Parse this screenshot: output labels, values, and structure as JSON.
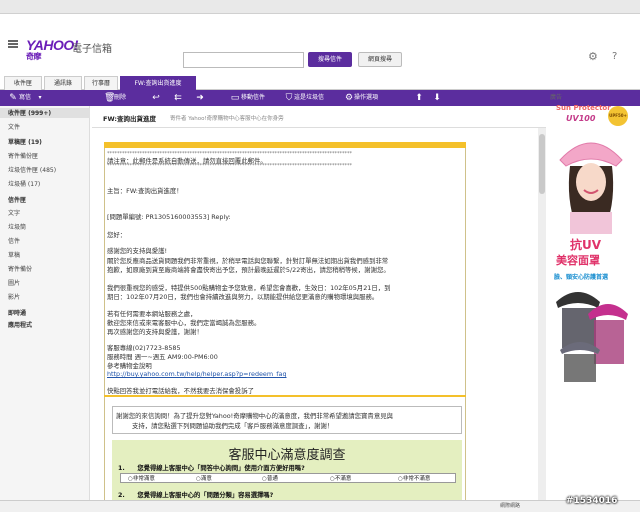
{
  "browser": {
    "bar": ""
  },
  "header": {
    "logo": "YAHOO!",
    "logo_sub": "奇摩",
    "mail_title": "電子信箱",
    "search_placeholder": "",
    "search_mail_label": "搜尋信件",
    "search_web_label": "網頁搜尋"
  },
  "tabs": [
    {
      "label": "收件匣"
    },
    {
      "label": "通訊錄"
    },
    {
      "label": "行事曆"
    },
    {
      "label": "FW:查詢出貨進度"
    }
  ],
  "toolbar": {
    "compose": "寫信",
    "delete": "刪除",
    "move": "移動信件",
    "spam": "這是垃圾信",
    "actions": "操作選項"
  },
  "sidebar": {
    "inbox": "收件匣 (999+)",
    "drafts": "文件",
    "draftbox": "草稿匣 (19)",
    "sent": "寄件備份匣",
    "spam": "垃圾信件匣 (485)",
    "trash": "垃圾桶 (17)",
    "folders_head": "信件匣",
    "folder1": "文字",
    "folder2": "垃圾筒",
    "folder3": "信件",
    "folder4": "草稿",
    "folder5": "寄件備份",
    "folder6": "圖片",
    "folder7": "影片",
    "apps_head": "即時通",
    "apps2_head": "應用程式"
  },
  "message": {
    "subject": "FW:查詢出貨進度",
    "from": "寄件者 Yahoo!奇摩購物中心客服中心在你身旁",
    "dash": "**************************************************************************************************",
    "warning": "請注意：此郵件是系統自動傳送，請勿直接回覆此郵件。",
    "dash2": "**************************************************************************************************",
    "topic": "主旨：FW:查詢出貨進度！",
    "ticket": "[問題單編號: PR1305160003553] Reply:",
    "greeting": "您好：",
    "thanks": "感謝您的支持與愛護!",
    "p1a": "關於您反應商品送貨問題我們非常重視，於稍早電話與您聯繫，針對訂單無法如期出貨我們感到非常",
    "p1b": "抱歉，如原廠到貨至廠商端將會盡快寄出予您，預計最晚延遲於5/22寄出，請您稍稍等候，謝謝您。",
    "p2a": "我們很重視您的感受，特提供500點購物金予您致意，希望您會喜歡，生效日：102年05月21日，到",
    "p2b": "期日：102年07月20日，我們也會持續改進與努力，以期能提供給您更滿意的購物環境與服務。",
    "p3a": "若有任何需要本網站服務之處，",
    "p3b": "歡迎您來信或來電客服中心，我們定當竭誠為您服務。",
    "p3c": "再次感謝您的支持與愛護，謝謝！",
    "contact1": "客服專線(02)7723-8585",
    "contact2": "服務時間 週一~週五 AM9:00-PM6:00",
    "contact3": "參考購物金說明",
    "link": "http://buy.yahoo.com.tw/help/helper.asp?p=redeem_faq",
    "hurry": "快點回答我並打電話給我，不然我要去消保會投訴了",
    "survey_intro_a": "謝謝您的來信詢問！為了提升您對Yahoo!奇摩購物中心的滿意度，我們非常希望邀請您寶貴意見與",
    "survey_intro_b": "支持，請您點選下列問題協助我們完成「客戶服務滿意度調查」，謝謝！",
    "survey_title": "客服中心滿意度調查",
    "q1": "1.　　您覺得線上客服中心「問答中心詢問」使用介面方便好用嗎?",
    "options": [
      "非常滿意",
      "滿意",
      "普通",
      "不滿意",
      "非常不滿意"
    ],
    "q2": "2.　　您覺得線上客服中心的「問題分類」容易選擇嗎?"
  },
  "ad": {
    "label": "廣告",
    "brand": "Sun Protector",
    "uv": "UV100",
    "badge": "UPF50+",
    "line1": "抗UV",
    "line2": "美容面罩",
    "line3": "臉、頸安心防護首選"
  },
  "watermark": "#1534016",
  "status": "網際網路"
}
